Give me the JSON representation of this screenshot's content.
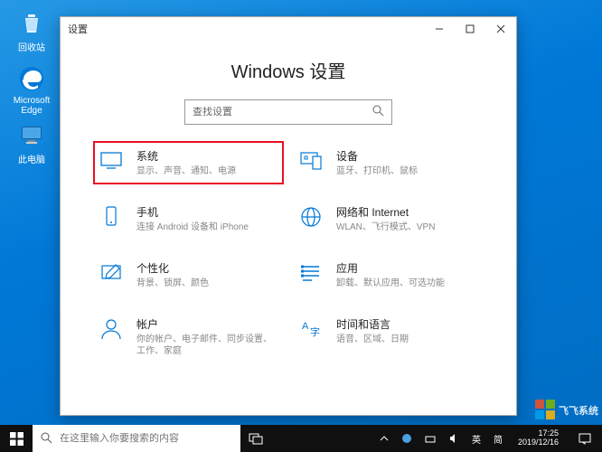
{
  "desktop_icons": {
    "recycle": "回收站",
    "edge": "Microsoft\nEdge",
    "thispc": "此电脑"
  },
  "settings": {
    "window_title": "设置",
    "page_title": "Windows 设置",
    "search_placeholder": "查找设置",
    "cards": {
      "system": {
        "title": "系统",
        "desc": "显示、声音、通知、电源"
      },
      "devices": {
        "title": "设备",
        "desc": "蓝牙、打印机、鼠标"
      },
      "phone": {
        "title": "手机",
        "desc": "连接 Android 设备和 iPhone"
      },
      "network": {
        "title": "网络和 Internet",
        "desc": "WLAN、飞行模式、VPN"
      },
      "personalization": {
        "title": "个性化",
        "desc": "背景、锁屏、颜色"
      },
      "apps": {
        "title": "应用",
        "desc": "卸载、默认应用、可选功能"
      },
      "accounts": {
        "title": "帐户",
        "desc": "你的帐户、电子邮件、同步设置、工作、家庭"
      },
      "time": {
        "title": "时间和语言",
        "desc": "语音、区域、日期"
      }
    }
  },
  "taskbar": {
    "search_placeholder": "在这里输入你要搜索的内容",
    "ime": "英",
    "ime2": "简",
    "time": "17:25",
    "date": "2019/12/16"
  },
  "watermark": "飞飞系统"
}
